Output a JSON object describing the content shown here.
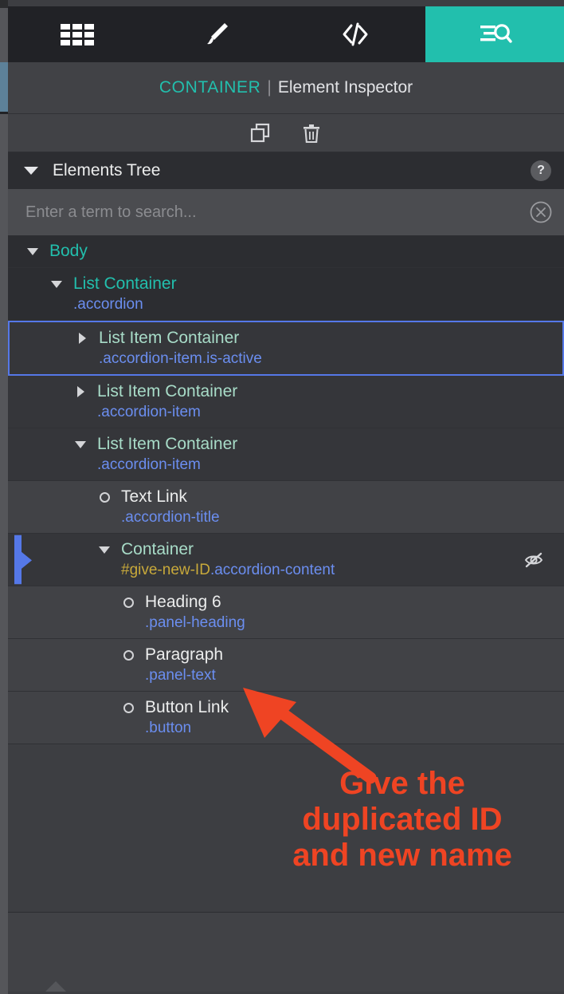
{
  "tabs": [
    {
      "name": "pages-tab",
      "icon": "grid-icon",
      "active": false
    },
    {
      "name": "style-tab",
      "icon": "brush-icon",
      "active": false
    },
    {
      "name": "code-tab",
      "icon": "code-icon",
      "active": false
    },
    {
      "name": "inspector-tab",
      "icon": "inspector-icon",
      "active": true
    }
  ],
  "header": {
    "element_type": "CONTAINER",
    "separator": "|",
    "panel_title": "Element Inspector"
  },
  "toolbar": {
    "duplicate_label": "duplicate-icon",
    "delete_label": "trash-icon"
  },
  "section": {
    "title": "Elements Tree",
    "help_label": "?",
    "collapse_icon": "chevron-down-icon"
  },
  "search": {
    "value": "",
    "placeholder": "Enter a term to search...",
    "clear_icon": "clear-circle-icon"
  },
  "tree": [
    {
      "label": "Body",
      "selector": "",
      "id": "",
      "depth": 0,
      "twisty": "down",
      "shade": "a",
      "selected": false,
      "hidden": false,
      "color": "green",
      "dragmarker": false
    },
    {
      "label": "List Container",
      "selector": ".accordion",
      "id": "",
      "depth": 1,
      "twisty": "down",
      "shade": "a",
      "selected": false,
      "hidden": false,
      "color": "green",
      "dragmarker": false
    },
    {
      "label": "List Item Container",
      "selector": ".accordion-item.is-active",
      "id": "",
      "depth": 2,
      "twisty": "right",
      "shade": "b",
      "selected": true,
      "hidden": false,
      "color": "green-pale",
      "dragmarker": false
    },
    {
      "label": "List Item Container",
      "selector": ".accordion-item",
      "id": "",
      "depth": 2,
      "twisty": "right",
      "shade": "b",
      "selected": false,
      "hidden": false,
      "color": "green-pale",
      "dragmarker": false
    },
    {
      "label": "List Item Container",
      "selector": ".accordion-item",
      "id": "",
      "depth": 2,
      "twisty": "down",
      "shade": "b",
      "selected": false,
      "hidden": false,
      "color": "green-pale",
      "dragmarker": false
    },
    {
      "label": "Text Link",
      "selector": ".accordion-title",
      "id": "",
      "depth": 3,
      "twisty": "dot",
      "shade": "c",
      "selected": false,
      "hidden": false,
      "color": "white",
      "dragmarker": false
    },
    {
      "label": "Container",
      "selector": ".accordion-content",
      "id": "#give-new-ID",
      "depth": 3,
      "twisty": "down",
      "shade": "b",
      "selected": false,
      "hidden": true,
      "color": "green-pale",
      "dragmarker": true
    },
    {
      "label": "Heading 6",
      "selector": ".panel-heading",
      "id": "",
      "depth": 4,
      "twisty": "dot",
      "shade": "c",
      "selected": false,
      "hidden": false,
      "color": "white",
      "dragmarker": false
    },
    {
      "label": "Paragraph",
      "selector": ".panel-text",
      "id": "",
      "depth": 4,
      "twisty": "dot",
      "shade": "c",
      "selected": false,
      "hidden": false,
      "color": "white",
      "dragmarker": false
    },
    {
      "label": "Button Link",
      "selector": ".button",
      "id": "",
      "depth": 4,
      "twisty": "dot",
      "shade": "c",
      "selected": false,
      "hidden": false,
      "color": "white",
      "dragmarker": false
    }
  ],
  "annotation": {
    "line1": "Give the",
    "line2": "duplicated ID",
    "line3": "and new name",
    "color": "#ef4423",
    "arrow": "arrow-up-left-icon"
  },
  "colors": {
    "accent_teal": "#22bfad",
    "selection_blue": "#5578e8",
    "selector_blue": "#6b8ef0",
    "id_gold": "#c8a93a",
    "annotation_red": "#ef4423"
  }
}
